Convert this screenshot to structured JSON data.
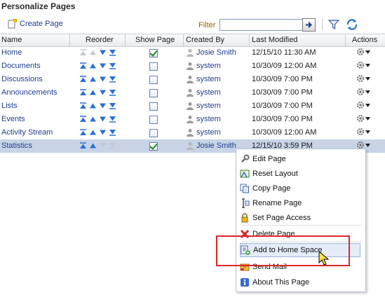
{
  "page_title": "Personalize Pages",
  "toolbar": {
    "create_label": "Create Page",
    "filter_label": "Filter",
    "filter_value": ""
  },
  "columns": {
    "name": "Name",
    "reorder": "Reorder",
    "show_page": "Show Page",
    "created_by": "Created By",
    "last_modified": "Last Modified",
    "actions": "Actions"
  },
  "rows": [
    {
      "name": "Home",
      "shown": true,
      "created_by": "Josie Smith",
      "modified": "12/15/10 11:30 AM"
    },
    {
      "name": "Documents",
      "shown": false,
      "created_by": "system",
      "modified": "10/30/09 12:00 AM"
    },
    {
      "name": "Discussions",
      "shown": false,
      "created_by": "system",
      "modified": "10/30/09 7:00 PM"
    },
    {
      "name": "Announcements",
      "shown": false,
      "created_by": "system",
      "modified": "10/30/09 7:00 PM"
    },
    {
      "name": "Lists",
      "shown": false,
      "created_by": "system",
      "modified": "10/30/09 7:00 PM"
    },
    {
      "name": "Events",
      "shown": false,
      "created_by": "system",
      "modified": "10/30/09 7:00 PM"
    },
    {
      "name": "Activity Stream",
      "shown": false,
      "created_by": "system",
      "modified": "10/30/09 12:00 AM"
    },
    {
      "name": "Statistics",
      "shown": true,
      "created_by": "Josie Smith",
      "modified": "12/15/10 3:59 PM",
      "selected": true
    }
  ],
  "menu": {
    "items": [
      {
        "label": "Edit Page",
        "icon": "wrench-icon"
      },
      {
        "label": "Reset Layout",
        "icon": "reset-layout-icon"
      },
      {
        "label": "Copy Page",
        "icon": "copy-icon"
      },
      {
        "label": "Rename Page",
        "icon": "rename-icon"
      },
      {
        "label": "Set Page Access",
        "icon": "lock-icon"
      },
      {
        "label": "Delete Page",
        "icon": "delete-x-icon"
      },
      {
        "label": "Add to Home Space",
        "icon": "add-page-icon"
      },
      {
        "label": "Send Mail",
        "icon": "mail-icon"
      },
      {
        "label": "About This Page",
        "icon": "info-icon"
      }
    ]
  },
  "colors": {
    "link": "#1f3f8c",
    "selected_row": "#c8d3e6",
    "highlight_box": "#e0262b",
    "reorder_arrow": "#2a6fd6"
  }
}
